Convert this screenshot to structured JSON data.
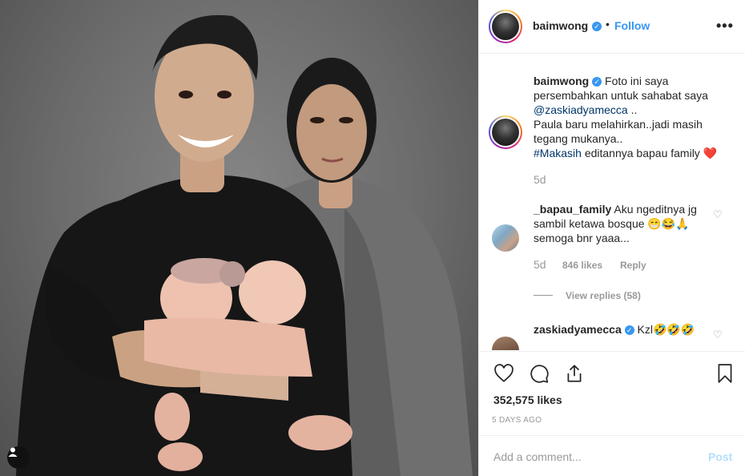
{
  "post": {
    "username": "baimwong",
    "follow_label": "Follow",
    "dot": "•",
    "more_label": "•••"
  },
  "caption": {
    "username": "baimwong",
    "text_1": "Foto ini saya persembahkan untuk sahabat saya",
    "mention": "@zaskiadyamecca",
    "text_2": "..",
    "text_3": "Paula baru melahirkan..jadi masih tegang mukanya..",
    "hashtag": "#Makasih",
    "text_4": "editannya bapau family",
    "emoji": "❤️",
    "time": "5d"
  },
  "comments": [
    {
      "username": "_bapau_family",
      "text": "Aku ngeditnya jg sambil ketawa bosque 😁😂🙏 semoga bnr yaaa...",
      "time": "5d",
      "likes": "846 likes",
      "reply_label": "Reply",
      "view_replies": "View replies (58)"
    },
    {
      "username": "zaskiadyamecca",
      "text": "Kzl🤣🤣🤣"
    }
  ],
  "stats": {
    "likes": "352,575 likes",
    "date": "5 DAYS AGO"
  },
  "add_comment": {
    "placeholder": "Add a comment...",
    "post_label": "Post"
  },
  "icons": {
    "verified": "verified-badge-icon",
    "like": "heart-outline-icon",
    "comment": "speech-bubble-icon",
    "share": "share-icon",
    "save": "bookmark-icon",
    "user_tag": "user-tag-icon"
  },
  "colors": {
    "link": "#003569",
    "accent": "#3897f0",
    "muted": "#999999",
    "heart": "#ed4956"
  }
}
